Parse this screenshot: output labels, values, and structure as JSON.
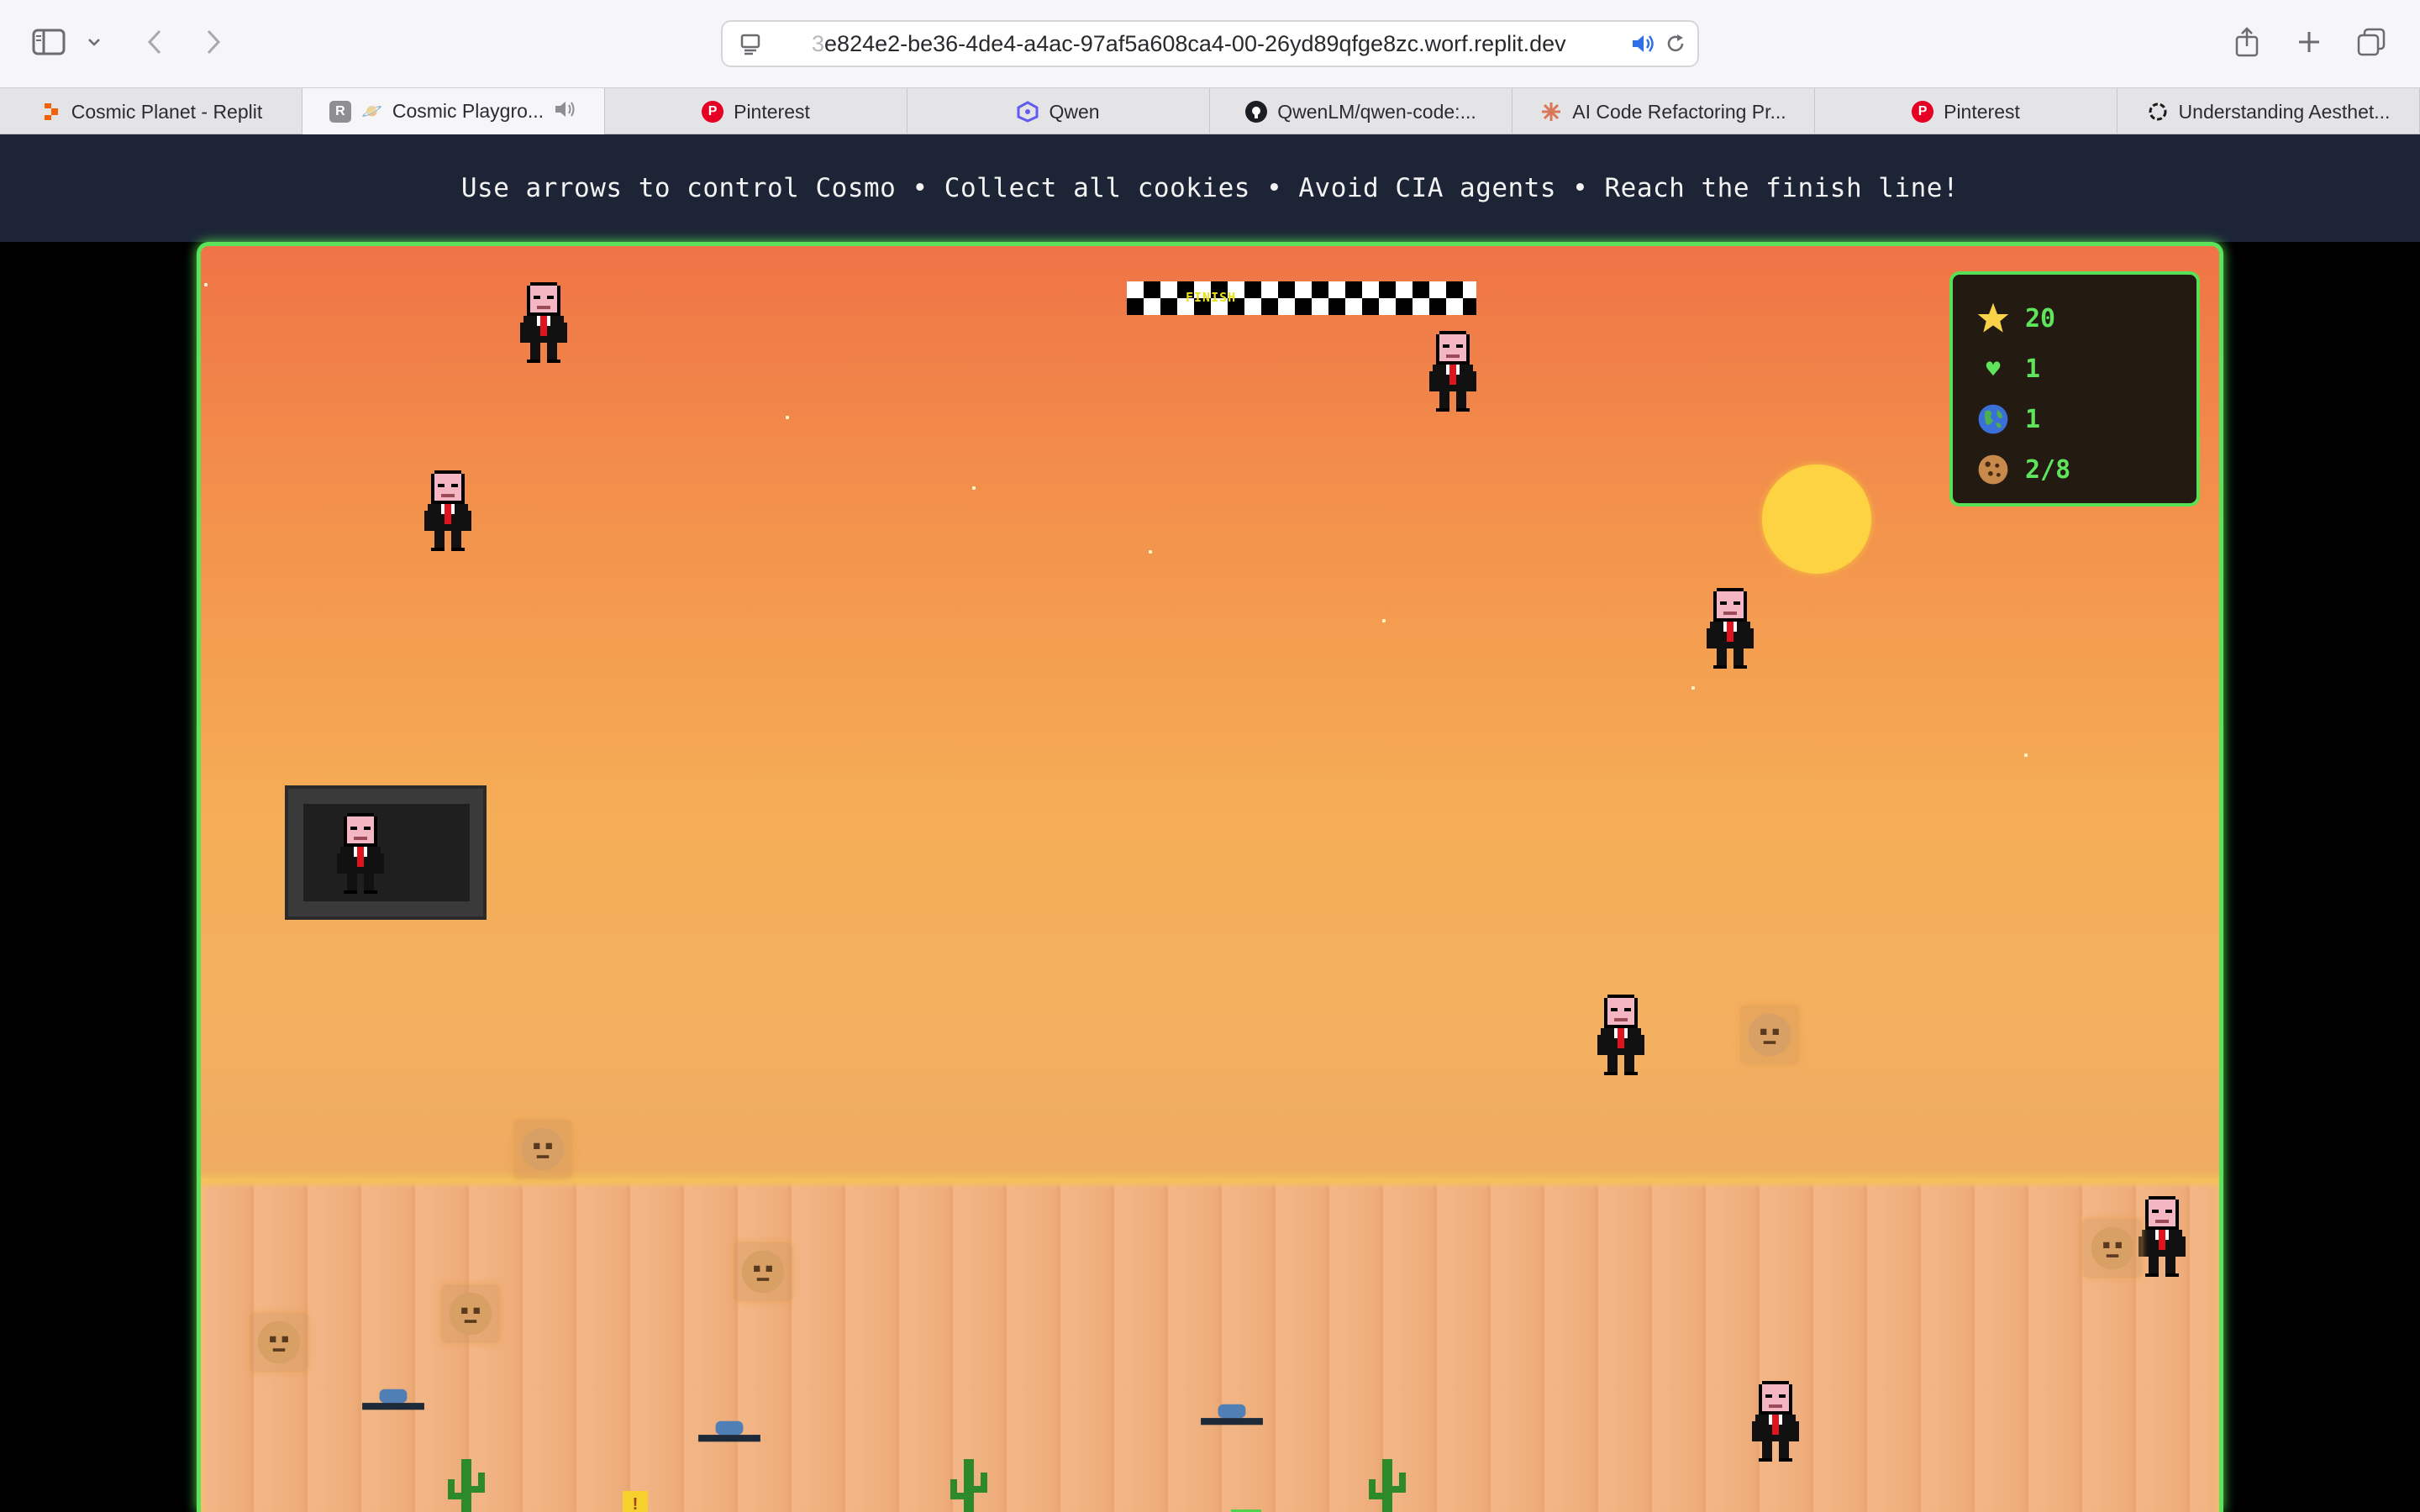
{
  "browser": {
    "url_faded": "3",
    "url_main": "e824e2-be36-4de4-a4ac-97af5a608ca4-00-26yd89qfge8zc.worf.replit.dev",
    "tabs": [
      {
        "label": "Cosmic Planet - Replit",
        "favicon": "replit-icon",
        "color": "#f26207",
        "active": false
      },
      {
        "label": "Cosmic Playgro...",
        "favicon": "replit-r-icon",
        "color": "#8e8e93",
        "active": true
      },
      {
        "label": "Pinterest",
        "favicon": "pinterest-icon",
        "color": "#e60023",
        "active": false
      },
      {
        "label": "Qwen",
        "favicon": "qwen-icon",
        "color": "#615ced",
        "active": false
      },
      {
        "label": "QwenLM/qwen-code:...",
        "favicon": "github-icon",
        "color": "#1b1f23",
        "active": false
      },
      {
        "label": "AI Code Refactoring Pr...",
        "favicon": "claude-icon",
        "color": "#d97757",
        "active": false
      },
      {
        "label": "Pinterest",
        "favicon": "pinterest-icon",
        "color": "#e60023",
        "active": false
      },
      {
        "label": "Understanding Aesthet...",
        "favicon": "openai-icon",
        "color": "#1a1a1a",
        "active": false
      }
    ]
  },
  "banner": {
    "instructions": "Use arrows to control Cosmo • Collect all cookies • Avoid CIA agents • Reach the finish line!"
  },
  "game": {
    "finish_label": "FINISH",
    "hud": {
      "score": "20",
      "lives": "1",
      "level": "1",
      "cookies": "2/8"
    },
    "sign_label": "!",
    "colors": {
      "border": "#5de35a",
      "hud_text": "#5fe45b",
      "sun": "#fdd344",
      "sky_top": "#ef7446",
      "sky_bottom": "#eba364"
    }
  }
}
